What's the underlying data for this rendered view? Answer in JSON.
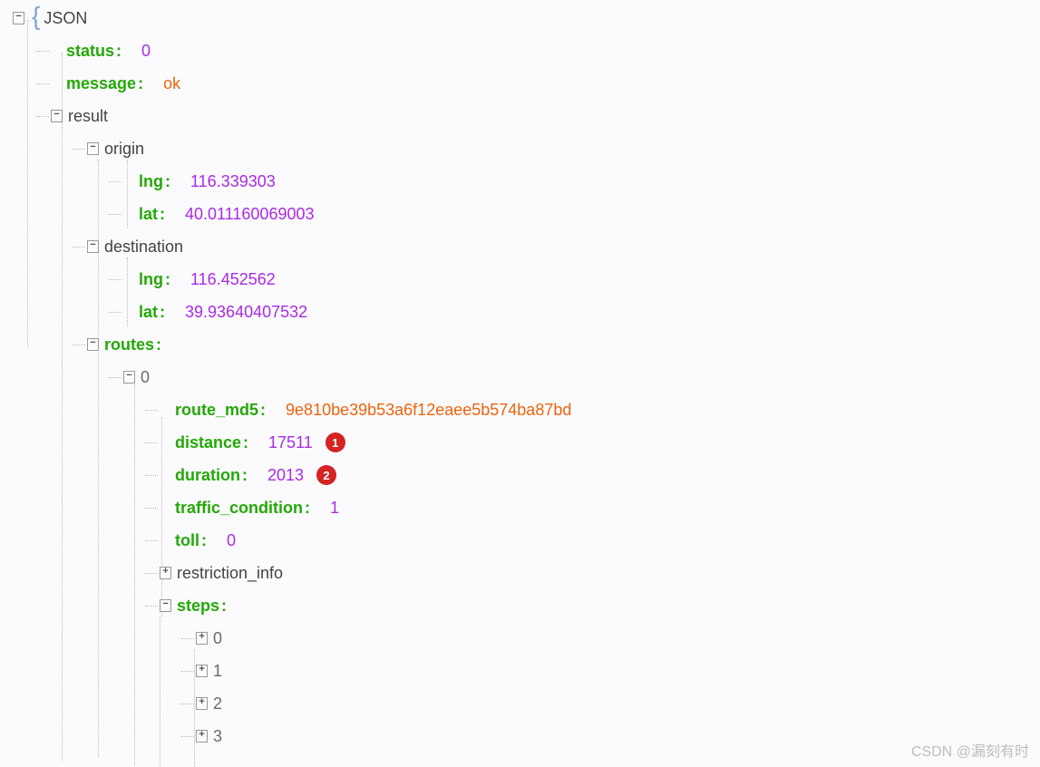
{
  "root": {
    "label": "JSON"
  },
  "status": {
    "key": "status",
    "value": "0"
  },
  "message": {
    "key": "message",
    "value": "ok"
  },
  "result": {
    "key": "result"
  },
  "origin": {
    "key": "origin",
    "lng_key": "lng",
    "lng": "116.339303",
    "lat_key": "lat",
    "lat": "40.011160069003"
  },
  "dest": {
    "key": "destination",
    "lng_key": "lng",
    "lng": "116.452562",
    "lat_key": "lat",
    "lat": "39.93640407532"
  },
  "routes": {
    "key": "routes",
    "idx": "0",
    "route_md5_key": "route_md5",
    "route_md5": "9e810be39b53a6f12eaee5b574ba87bd",
    "distance_key": "distance",
    "distance": "17511",
    "duration_key": "duration",
    "duration": "2013",
    "traffic_key": "traffic_condition",
    "traffic": "1",
    "toll_key": "toll",
    "toll": "0",
    "restriction_key": "restriction_info",
    "steps_key": "steps",
    "steps": [
      "0",
      "1",
      "2",
      "3"
    ]
  },
  "ann": {
    "a1": "1",
    "a2": "2"
  },
  "watermark": "CSDN @漏刻有时",
  "glyph": {
    "minus": "−",
    "plus": "+"
  }
}
